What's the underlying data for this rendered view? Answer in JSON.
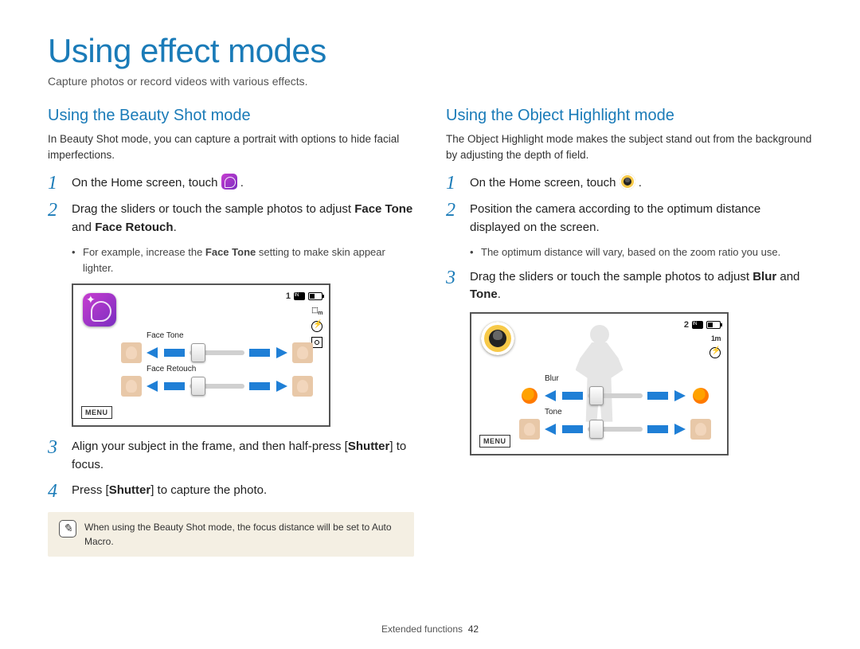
{
  "page": {
    "title": "Using effect modes",
    "subtitle": "Capture photos or record videos with various effects."
  },
  "left": {
    "heading": "Using the Beauty Shot mode",
    "desc": "In Beauty Shot mode, you can capture a portrait with options to hide facial imperfections.",
    "steps": {
      "s1_pre": "On the Home screen, touch ",
      "s1_post": ".",
      "s2_a": "Drag the sliders or touch the sample photos to adjust ",
      "s2_b1": "Face Tone",
      "s2_mid": " and ",
      "s2_b2": "Face Retouch",
      "s2_c": ".",
      "bullet_a": "For example, increase the ",
      "bullet_b": "Face Tone",
      "bullet_c": " setting to make skin appear lighter.",
      "s3_a": "Align your subject in the frame, and then half-press [",
      "s3_b": "Shutter",
      "s3_c": "] to focus.",
      "s4_a": "Press [",
      "s4_b": "Shutter",
      "s4_c": "] to capture the photo."
    },
    "screen": {
      "menu": "MENU",
      "count": "1",
      "res": "",
      "slider1_label": "Face Tone",
      "slider2_label": "Face Retouch"
    },
    "note": "When using the Beauty Shot mode, the focus distance will be set to Auto Macro."
  },
  "right": {
    "heading": "Using the Object Highlight mode",
    "desc": "The Object Highlight mode makes the subject stand out from the background by adjusting the depth of field.",
    "steps": {
      "s1_pre": "On the Home screen, touch ",
      "s1_post": ".",
      "s2": "Position the camera according to the optimum distance displayed on the screen.",
      "bullet": "The optimum distance will vary, based on the zoom ratio you use.",
      "s3_a": "Drag the sliders or touch the sample photos to adjust ",
      "s3_b1": "Blur",
      "s3_mid": " and ",
      "s3_b2": "Tone",
      "s3_c": "."
    },
    "screen": {
      "menu": "MENU",
      "count": "2",
      "res": "1m",
      "slider1_label": "Blur",
      "slider2_label": "Tone"
    }
  },
  "footer": {
    "section": "Extended functions",
    "page": "42"
  }
}
